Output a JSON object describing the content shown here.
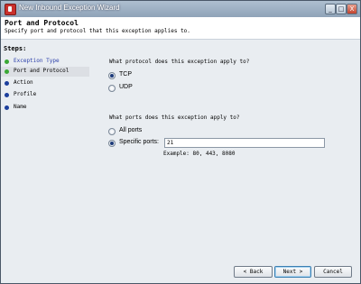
{
  "window": {
    "title": "New Inbound Exception Wizard",
    "controls": {
      "minimize": "_",
      "maximize": "□",
      "close": "X"
    }
  },
  "header": {
    "title": "Port and Protocol",
    "subtitle": "Specify port and protocol that this exception applies to."
  },
  "steps": {
    "heading": "Steps:",
    "items": [
      {
        "label": "Exception Type",
        "state": "done",
        "color": "#3aa835"
      },
      {
        "label": "Port and Protocol",
        "state": "current",
        "color": "#3aa835"
      },
      {
        "label": "Action",
        "state": "pending",
        "color": "#1c3f9c"
      },
      {
        "label": "Profile",
        "state": "pending",
        "color": "#1c3f9c"
      },
      {
        "label": "Name",
        "state": "pending",
        "color": "#1c3f9c"
      }
    ]
  },
  "protocol": {
    "question": "What protocol does this exception apply to?",
    "options": [
      {
        "label": "TCP",
        "checked": true
      },
      {
        "label": "UDP",
        "checked": false
      }
    ]
  },
  "ports": {
    "question": "What ports does this exception apply to?",
    "options": [
      {
        "label": "All ports",
        "checked": false
      },
      {
        "label": "Specific ports:",
        "checked": true
      }
    ],
    "value": "21",
    "example": "Example: 80, 443, 8080"
  },
  "buttons": {
    "back": "< Back",
    "next": "Next >",
    "cancel": "Cancel"
  }
}
